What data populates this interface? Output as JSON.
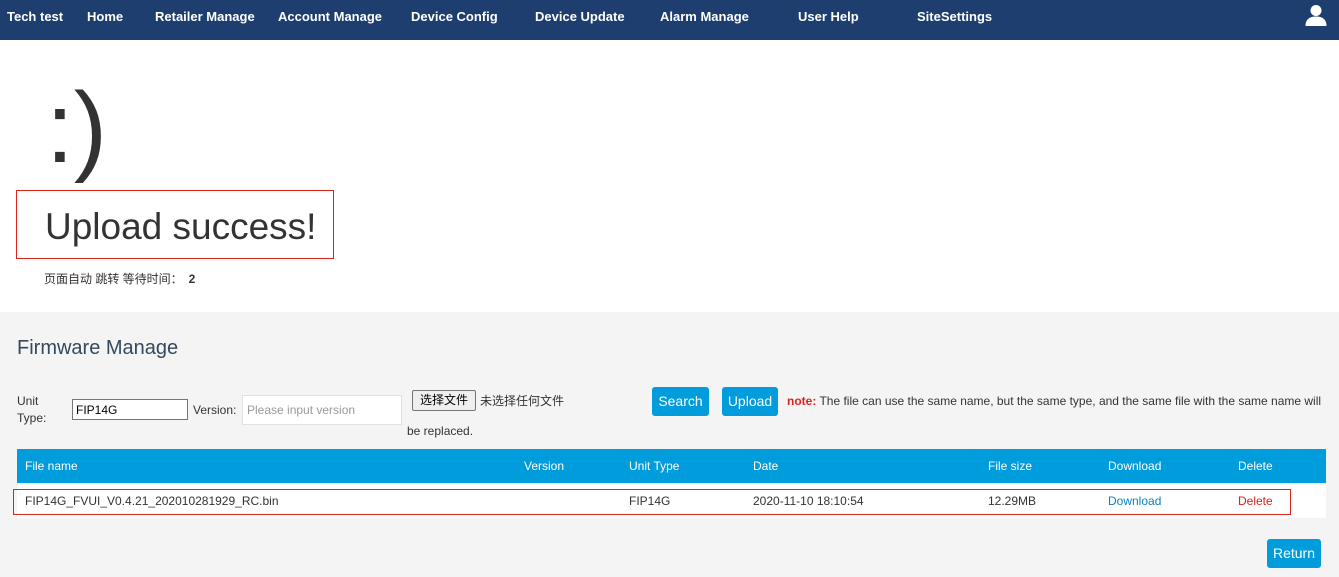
{
  "nav": {
    "brand": "Tech test",
    "items": [
      {
        "label": "Home"
      },
      {
        "label": "Retailer Manage"
      },
      {
        "label": "Account Manage"
      },
      {
        "label": "Device Config"
      },
      {
        "label": "Device Update"
      },
      {
        "label": "Alarm Manage"
      },
      {
        "label": "User Help"
      },
      {
        "label": "SiteSettings"
      }
    ],
    "user_icon": "user-icon"
  },
  "success": {
    "smiley": ":)",
    "message": "Upload success!",
    "redirect_text": "页面自动 跳转 等待时间：",
    "wait_seconds": "2"
  },
  "firmware": {
    "title": "Firmware Manage",
    "unit_type_label": "Unit Type:",
    "unit_type_value": "FIP14G",
    "version_label": "Version:",
    "version_placeholder": "Please input version",
    "choose_file_label": "选择文件",
    "no_file_text": "未选择任何文件",
    "search_label": "Search",
    "upload_label": "Upload",
    "note_label": "note:",
    "note_text": "The file can use the same name, but the same type, and the same file with the same name will",
    "note_text_cont": "be replaced."
  },
  "table": {
    "columns": [
      "File name",
      "Version",
      "Unit Type",
      "Date",
      "File size",
      "Download",
      "Delete"
    ],
    "rows": [
      {
        "file_name": "FIP14G_FVUI_V0.4.21_202010281929_RC.bin",
        "version": "",
        "unit_type": "FIP14G",
        "date": "2020-11-10 18:10:54",
        "file_size": "12.29MB",
        "download": "Download",
        "delete": "Delete"
      }
    ]
  },
  "return_label": "Return",
  "colors": {
    "nav_bg": "#1d3e6e",
    "accent": "#009cdb",
    "alert_red": "#d9231b",
    "panel_bg": "#f4f4f4"
  }
}
